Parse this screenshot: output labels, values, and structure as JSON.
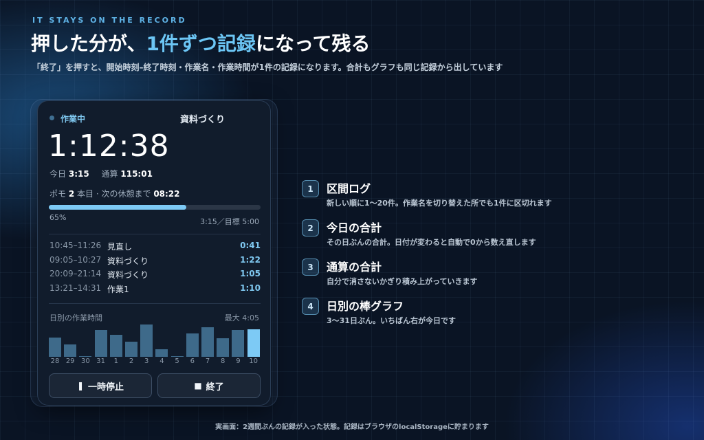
{
  "header": {
    "kicker": "IT STAYS ON THE RECORD",
    "title_pre": "押した分が、",
    "title_highlight": "1件ずつ記録",
    "title_post": "になって残る",
    "subtitle": "「終了」を押すと、開始時刻–終了時刻・作業名・作業時間が1件の記録になります。合計もグラフも同じ記録から出しています"
  },
  "card": {
    "status": "作業中",
    "task_name": "資料づくり",
    "timer": "1:12:38",
    "today_label": "今日",
    "today_value": "3:15",
    "total_label": "通算",
    "total_value": "115:01",
    "pomo_label": "ポモ",
    "pomo_count": "2",
    "pomo_suffix": "本目 · 次の休憩まで",
    "pomo_remaining": "08:22",
    "progress_percent": 65,
    "progress_text": "65%",
    "goal_text": "3:15／目標 5:00",
    "log": [
      {
        "time": "10:45–11:26",
        "name": "見直し",
        "duration": "0:41"
      },
      {
        "time": "09:05–10:27",
        "name": "資料づくり",
        "duration": "1:22"
      },
      {
        "time": "20:09–21:14",
        "name": "資料づくり",
        "duration": "1:05"
      },
      {
        "time": "13:21–14:31",
        "name": "作業1",
        "duration": "1:10"
      }
    ],
    "chart_title": "日別の作業時間",
    "chart_max": "最大 4:05",
    "pause_icon": "pause-icon",
    "pause_label": "一時停止",
    "stop_icon": "stop-icon",
    "stop_label": "終了"
  },
  "chart_data": {
    "type": "bar",
    "categories": [
      "28",
      "29",
      "30",
      "31",
      "1",
      "2",
      "3",
      "4",
      "5",
      "6",
      "7",
      "8",
      "9",
      "10"
    ],
    "values": [
      2.3,
      1.5,
      0.1,
      3.2,
      2.6,
      1.8,
      3.8,
      0.9,
      0.1,
      2.8,
      3.5,
      2.2,
      3.2,
      3.25
    ],
    "unit": "hours",
    "ylim": [
      0,
      4.083
    ],
    "highlight_index": 13,
    "colors": {
      "bar": "#3e6a8a",
      "today": "#7dcaf5"
    }
  },
  "features": [
    {
      "num": "1",
      "title": "区間ログ",
      "desc": "新しい順に1〜20件。作業名を切り替えた所でも1件に区切れます"
    },
    {
      "num": "2",
      "title": "今日の合計",
      "desc": "その日ぶんの合計。日付が変わると自動で0から数え直します"
    },
    {
      "num": "3",
      "title": "通算の合計",
      "desc": "自分で消さないかぎり積み上がっていきます"
    },
    {
      "num": "4",
      "title": "日別の棒グラフ",
      "desc": "3〜31日ぶん。いちばん右が今日です"
    }
  ],
  "footer": "実画面：2週間ぶんの記録が入った状態。記録はブラウザのlocalStorageに貯まります",
  "colors": {
    "accent": "#7dcaf5",
    "background": "#0a1424",
    "card": "#111c2c"
  }
}
